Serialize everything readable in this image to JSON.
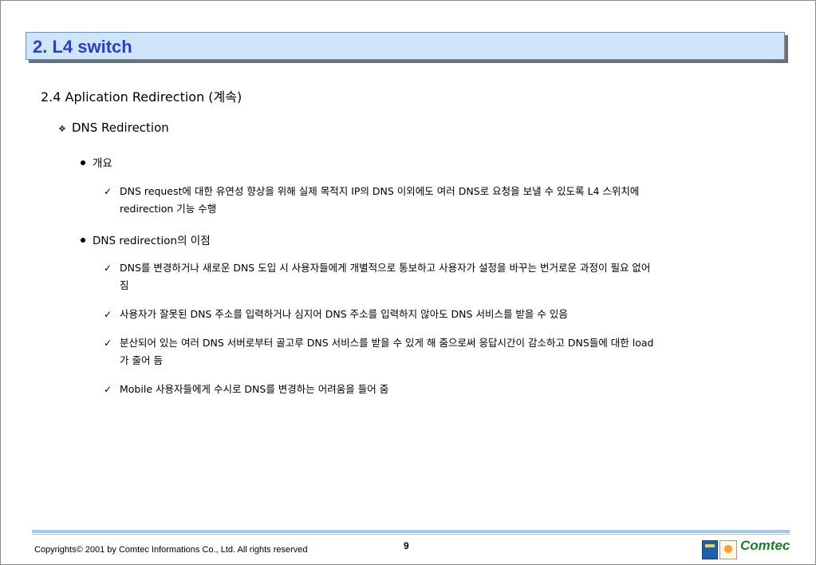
{
  "title": "2. L4 switch",
  "section_heading": "2.4  Aplication Redirection (계속)",
  "subsection": {
    "icon": "diamond-bullet-icon",
    "label": "DNS Redirection"
  },
  "bullets": [
    {
      "label": "개요",
      "items": [
        {
          "lines": [
            "DNS request에 대한 유연성 향상을 위해 실제 목적지 IP의 DNS 이외에도 여러 DNS로 요청을 보낼 수 있도록 L4 스위치에",
            "redirection 기능 수행"
          ]
        }
      ]
    },
    {
      "label": "DNS redirection의 이점",
      "items": [
        {
          "lines": [
            "DNS를 변경하거나 새로운 DNS 도입 시 사용자들에게 개별적으로 통보하고 사용자가 설정을 바꾸는 번거로운 과정이 필요 없어",
            "짐"
          ]
        },
        {
          "lines": [
            "사용자가 잘못된 DNS 주소를 입력하거나 심지어 DNS 주소를 입력하지 않아도 DNS 서비스를 받을 수 있음"
          ]
        },
        {
          "lines": [
            "분산되어 있는 여러 DNS 서버로부터 골고루 DNS 서비스를 받을 수 있게 해 줌으로써 응답시간이 감소하고 DNS들에 대한 load",
            "가 줄어 듬"
          ]
        },
        {
          "lines": [
            "Mobile 사용자들에게 수시로 DNS를 변경하는 어려움을 들어 줌"
          ]
        }
      ]
    }
  ],
  "check_mark": "✓",
  "footer": {
    "copyright": "Copyrights© 2001 by Comtec Informations Co., Ltd. All rights reserved",
    "page_number": "9",
    "logo_text": "Comtec"
  },
  "colors": {
    "title_text": "#2b3fc8",
    "title_bg": "#cfe6fa",
    "footer_line": "#9fc9ee",
    "logo_green": "#1f7a2a"
  }
}
